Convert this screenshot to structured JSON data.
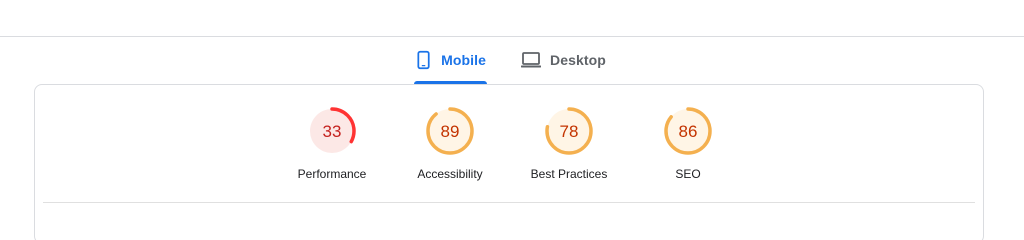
{
  "tabs": [
    {
      "label": "Mobile",
      "icon": "smartphone-icon",
      "selected": true
    },
    {
      "label": "Desktop",
      "icon": "laptop-icon",
      "selected": false
    }
  ],
  "scores": [
    {
      "value": 33,
      "label": "Performance",
      "rating": "poor"
    },
    {
      "value": 89,
      "label": "Accessibility",
      "rating": "average"
    },
    {
      "value": 78,
      "label": "Best Practices",
      "rating": "average"
    },
    {
      "value": 86,
      "label": "SEO",
      "rating": "average"
    }
  ],
  "colors": {
    "accent": "#1a73e8",
    "poor_stroke": "#f33",
    "poor_fill": "#fce8e6",
    "poor_text": "#c5221f",
    "average_stroke": "#f4b04f",
    "average_fill": "#fff5e6",
    "average_text": "#c33300"
  }
}
